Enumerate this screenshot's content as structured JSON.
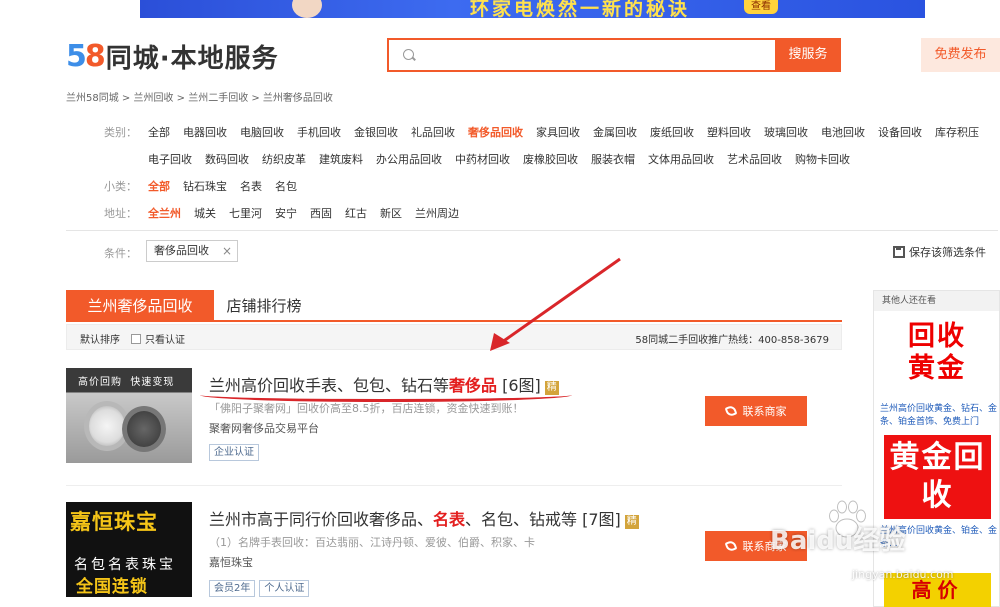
{
  "banner": {
    "text": "环家电焕然一新的秘诀",
    "button": "查看"
  },
  "header": {
    "logo_58": "58",
    "logo_text": "同城·本地服务",
    "search_placeholder": "",
    "search_button": "搜服务",
    "free_post": "免费发布"
  },
  "breadcrumb": "兰州58同城 > 兰州回收 > 兰州二手回收 > 兰州奢侈品回收",
  "filters": {
    "category_label": "类别：",
    "categories_row1": [
      "全部",
      "电器回收",
      "电脑回收",
      "手机回收",
      "金银回收",
      "礼品回收",
      "奢侈品回收",
      "家具回收",
      "金属回收",
      "废纸回收",
      "塑料回收",
      "玻璃回收",
      "电池回收",
      "设备回收",
      "库存积压"
    ],
    "categories_row2": [
      "电子回收",
      "数码回收",
      "纺织皮革",
      "建筑废料",
      "办公用品回收",
      "中药材回收",
      "废橡胶回收",
      "服装衣帽",
      "文体用品回收",
      "艺术品回收",
      "购物卡回收"
    ],
    "active_category": "奢侈品回收",
    "subcategory_label": "小类：",
    "subcategories": [
      "全部",
      "钻石珠宝",
      "名表",
      "名包"
    ],
    "area_label": "地址：",
    "areas": [
      "全兰州",
      "城关",
      "七里河",
      "安宁",
      "西固",
      "红古",
      "新区",
      "兰州周边"
    ]
  },
  "condition": {
    "label": "条件：",
    "tag": "奢侈品回收",
    "close": "×",
    "save": "保存该筛选条件"
  },
  "tabs": [
    "兰州奢侈品回收",
    "店铺排行榜"
  ],
  "sortbar": {
    "default": "默认排序",
    "verified": "只看认证",
    "hotline": "58同城二手回收推广热线：400-858-3679"
  },
  "listings": [
    {
      "thumb_texts": [
        "高价回购",
        "快速变现"
      ],
      "title_pre": "兰州高价回收手表、包包、钻石等",
      "title_hl": "奢侈品",
      "title_post": " [6图]",
      "jing": "精",
      "desc": "「佛阳子聚奢网」回收价高至8.5折，百店连锁，资金快速到账！",
      "shop": "聚奢网奢侈品交易平台",
      "badges": [
        "企业认证"
      ],
      "contact": "联系商家"
    },
    {
      "thumb_texts": [
        "嘉恒珠宝",
        "名包名表珠宝",
        "全国连锁"
      ],
      "title_pre": "兰州市高于同行价回收奢侈品、",
      "title_hl": "名表",
      "title_post": "、名包、钻戒等 [7图]",
      "jing": "精",
      "desc": "（1）名牌手表回收：百达翡丽、江诗丹顿、爱彼、伯爵、积家、卡",
      "shop": "嘉恒珠宝",
      "badges": [
        "会员2年",
        "个人认证"
      ],
      "contact": "联系商家"
    }
  ],
  "sidebar": {
    "head": "其他人还在看",
    "ad1": "回收黄金",
    "link1": "兰州高价回收黄金、钻石、金条、铂金首饰、免费上门",
    "ad2": "黄金回收",
    "link2": "兰州高价回收黄金、铂金、金条...",
    "ad3": "高价"
  },
  "watermark": {
    "main": "Baidu经验",
    "sub": "jingyan.baidu.com"
  }
}
